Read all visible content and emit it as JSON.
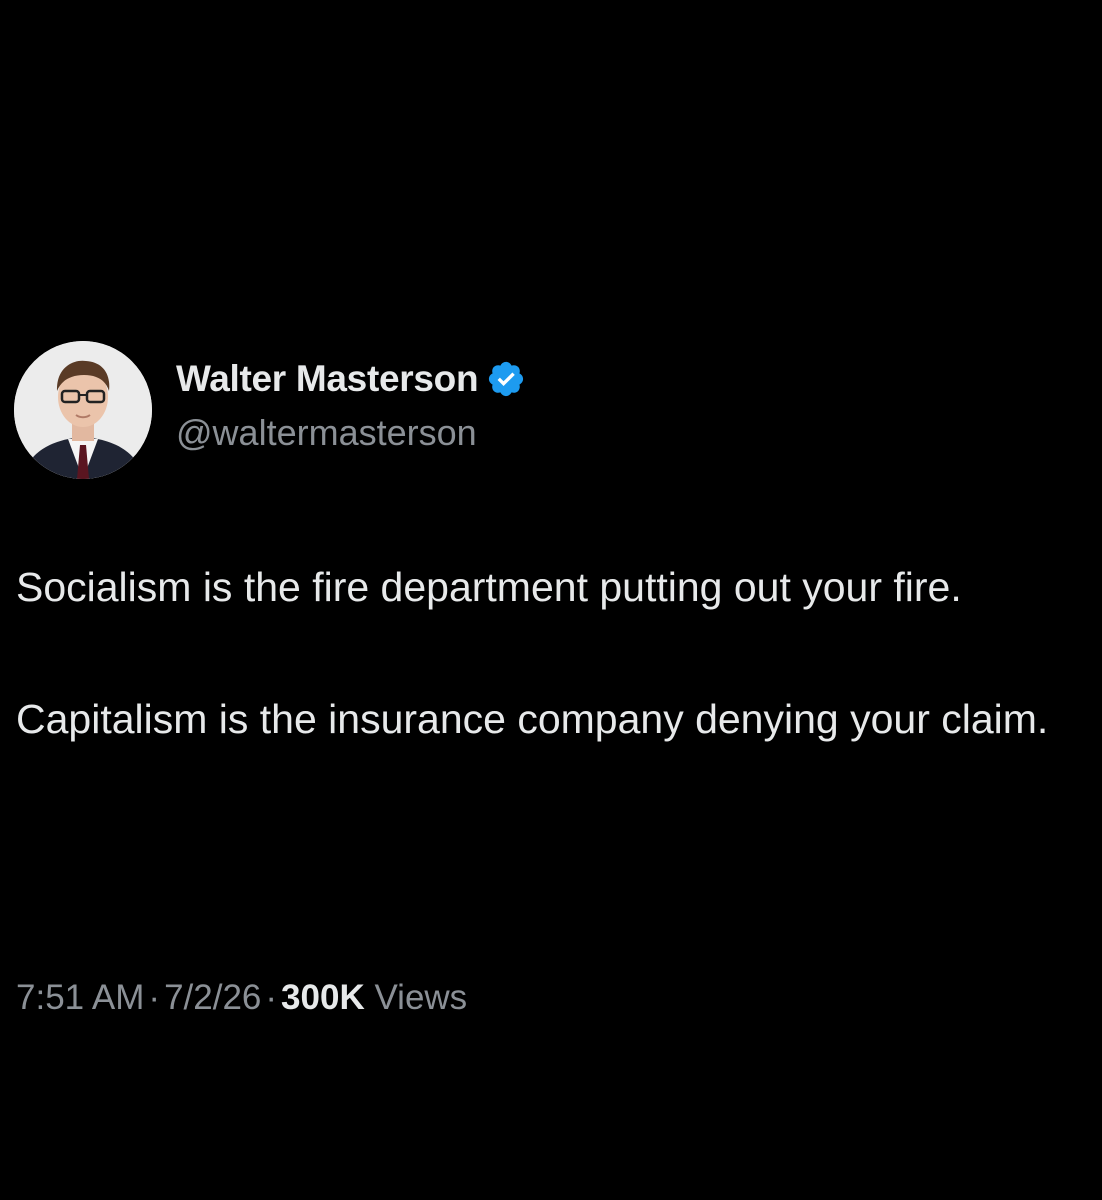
{
  "author": {
    "display_name": "Walter Masterson",
    "handle": "@waltermasterson",
    "verified_icon": "verified-badge-icon",
    "verified_color": "#1d9bf0"
  },
  "tweet": {
    "paragraphs": [
      "Socialism is the fire department putting out your fire.",
      "Capitalism is the insurance company denying your claim."
    ]
  },
  "meta": {
    "time": "7:51 AM",
    "separator": "·",
    "date": "7/2/26",
    "views_count": "300K",
    "views_label": "Views"
  },
  "colors": {
    "background": "#000000",
    "primary_text": "#e7e9ea",
    "secondary_text": "#8b9096"
  }
}
